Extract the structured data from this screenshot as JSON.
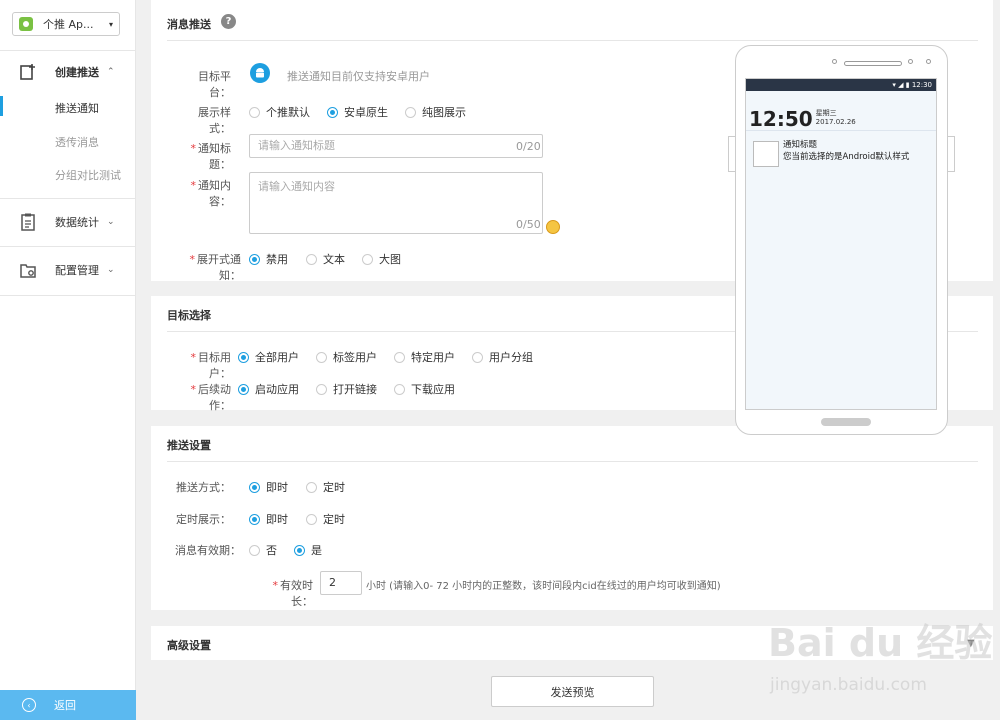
{
  "app_selector": {
    "label": "个推 Ap...",
    "arrow": "▾"
  },
  "sidebar": {
    "group1": {
      "label": "创建推送",
      "chev": "⌃"
    },
    "subs": [
      "推送通知",
      "透传消息",
      "分组对比测试"
    ],
    "group2": {
      "label": "数据统计",
      "chev": "⌄"
    },
    "group3": {
      "label": "配置管理",
      "chev": "⌄"
    },
    "back": "返回"
  },
  "message": {
    "title": "消息推送",
    "help": "?",
    "platform_label": "目标平台：",
    "platform_note": "推送通知目前仅支持安卓用户",
    "style_label": "展示样式：",
    "style_options": [
      "个推默认",
      "安卓原生",
      "纯图展示"
    ],
    "title_label": "通知标题：",
    "title_placeholder": "请输入通知标题",
    "title_count": "0/20",
    "content_label": "通知内容：",
    "content_placeholder": "请输入通知内容",
    "content_count": "0/50",
    "expand_label": "展开式通知：",
    "expand_options": [
      "禁用",
      "文本",
      "大图"
    ]
  },
  "target": {
    "title": "目标选择",
    "user_label": "目标用户：",
    "user_options": [
      "全部用户",
      "标签用户",
      "特定用户",
      "用户分组"
    ],
    "action_label": "后续动作：",
    "action_options": [
      "启动应用",
      "打开链接",
      "下载应用"
    ]
  },
  "push": {
    "title": "推送设置",
    "mode_label": "推送方式：",
    "mode_options": [
      "即时",
      "定时"
    ],
    "display_label": "定时展示：",
    "display_options": [
      "即时",
      "定时"
    ],
    "validity_label": "消息有效期：",
    "validity_options": [
      "否",
      "是"
    ],
    "duration_label": "有效时长：",
    "duration_value": "2",
    "duration_note": "小时 (请输入0- 72 小时内的正整数，该时间段内cid在线过的用户均可收到通知)"
  },
  "advanced": {
    "title": "高级设置",
    "arrow": "▼"
  },
  "preview": {
    "status_time": "12:30",
    "clock": "12:50",
    "weekday": "星期三",
    "date": "2017.02.26",
    "notif_title": "通知标题",
    "notif_body": "您当前选择的是Android默认样式"
  },
  "send_button": "发送预览",
  "watermark": {
    "brand": "Bai du 经验",
    "url": "jingyan.baidu.com"
  },
  "colors": {
    "accent": "#1e9fe0",
    "required": "#e4393c",
    "back_bar": "#5bb9f0"
  }
}
